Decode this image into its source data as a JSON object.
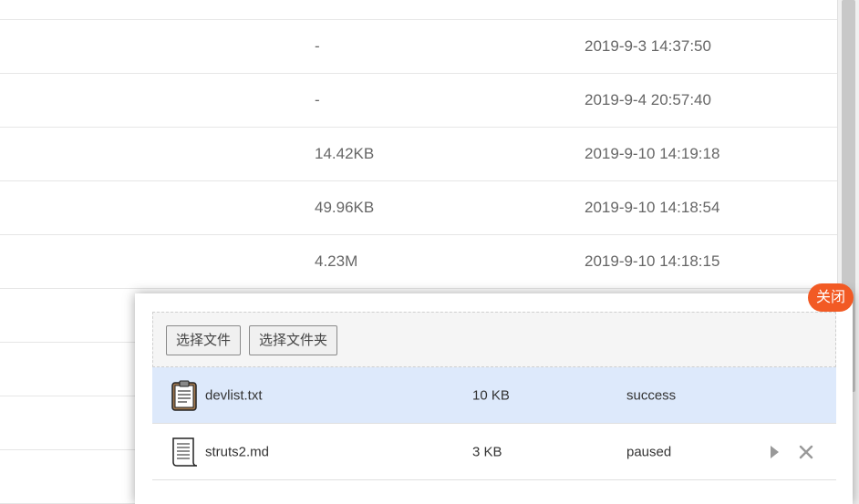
{
  "table": {
    "rows": [
      {
        "size": "",
        "date": ""
      },
      {
        "size": "-",
        "date": "2019-9-3 14:37:50"
      },
      {
        "size": "-",
        "date": "2019-9-4 20:57:40"
      },
      {
        "size": "14.42KB",
        "date": "2019-9-10 14:19:18"
      },
      {
        "size": "49.96KB",
        "date": "2019-9-10 14:18:54"
      },
      {
        "size": "4.23M",
        "date": "2019-9-10 14:18:15"
      },
      {
        "size": "",
        "date": ""
      },
      {
        "size": "",
        "date": ""
      },
      {
        "size": "",
        "date": ""
      },
      {
        "size": "",
        "date": ""
      }
    ]
  },
  "upload": {
    "close_label": "关闭",
    "pick_file_label": "选择文件",
    "pick_folder_label": "选择文件夹",
    "files": [
      {
        "name": "devlist.txt",
        "size": "10 KB",
        "status": "success",
        "icon": "clipboard-icon"
      },
      {
        "name": "struts2.md",
        "size": "3 KB",
        "status": "paused",
        "icon": "document-icon"
      }
    ]
  },
  "colors": {
    "close_button": "#f25a24",
    "active_row": "#dde9fb"
  }
}
